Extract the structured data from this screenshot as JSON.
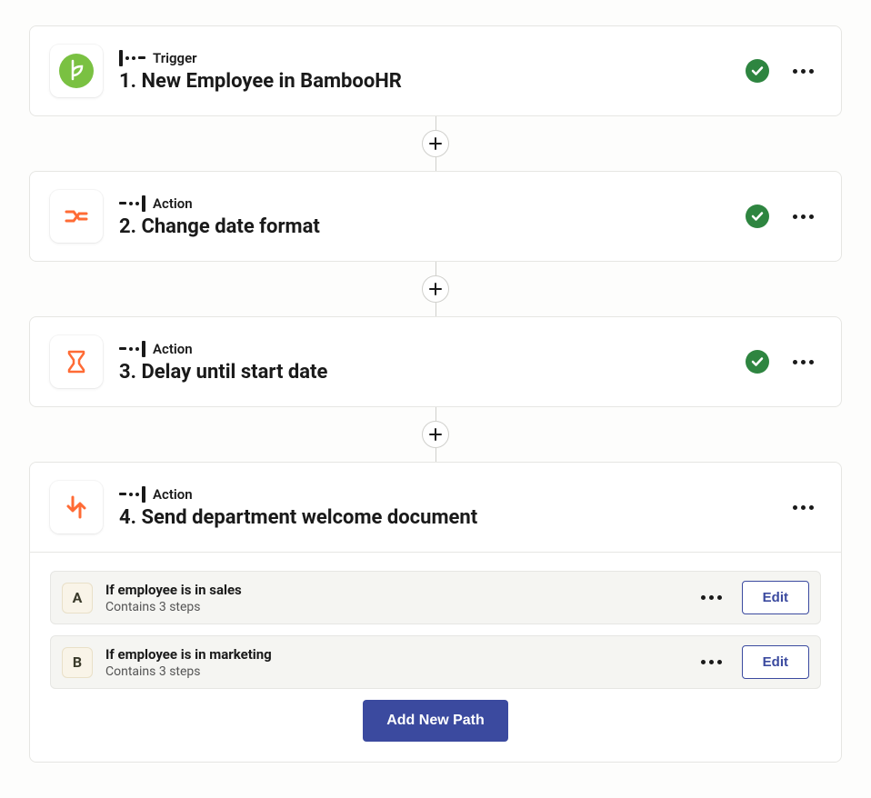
{
  "steps": [
    {
      "type_label": "Trigger",
      "title": "1. New Employee in BambooHR",
      "has_check": true,
      "icon": "bamboohr",
      "paths": null
    },
    {
      "type_label": "Action",
      "title": "2. Change date format",
      "has_check": true,
      "icon": "formatter",
      "paths": null
    },
    {
      "type_label": "Action",
      "title": "3. Delay until start date",
      "has_check": true,
      "icon": "delay",
      "paths": null
    },
    {
      "type_label": "Action",
      "title": "4. Send department welcome document",
      "has_check": false,
      "icon": "paths",
      "paths": [
        {
          "badge": "A",
          "title": "If employee is in sales",
          "sub": "Contains 3 steps",
          "edit": "Edit"
        },
        {
          "badge": "B",
          "title": "If employee is in marketing",
          "sub": "Contains 3 steps",
          "edit": "Edit"
        }
      ],
      "add_path_label": "Add New Path"
    }
  ]
}
